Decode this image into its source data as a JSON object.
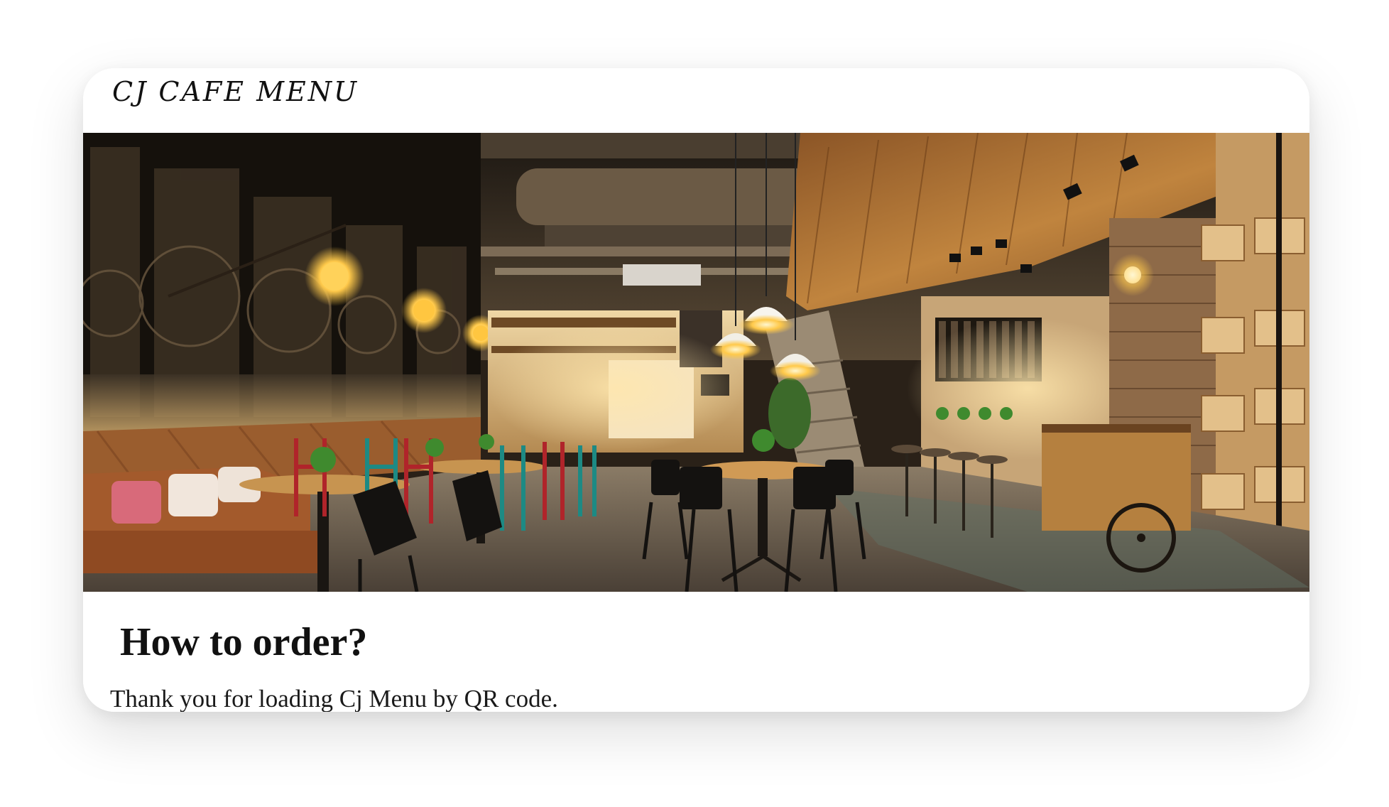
{
  "header": {
    "brand": "CJ CAFE MENU"
  },
  "hero": {
    "image_alt": "Cafe interior photo",
    "icon": "cafe-interior-image"
  },
  "content": {
    "title": "How to order?",
    "intro_text": "Thank you for loading Cj Menu by QR code."
  },
  "colors": {
    "card_background": "#ffffff",
    "text_primary": "#111111",
    "wood_accent": "#a86a36",
    "dark_interior": "#2a2118"
  }
}
